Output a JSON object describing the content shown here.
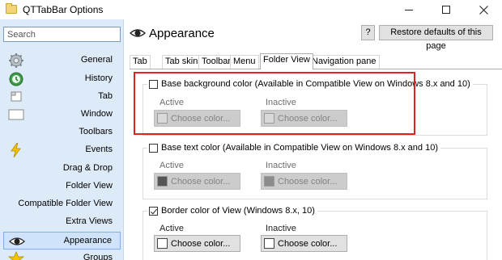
{
  "window": {
    "title": "QTTabBar Options",
    "controls": [
      "minimize",
      "maximize",
      "close"
    ]
  },
  "sidebar": {
    "search_placeholder": "Search",
    "items": [
      {
        "label": "General",
        "icon": "gear-icon"
      },
      {
        "label": "History",
        "icon": "history-icon"
      },
      {
        "label": "Tab",
        "icon": "tab-icon"
      },
      {
        "label": "Window",
        "icon": "window-icon"
      },
      {
        "label": "Toolbars",
        "icon": ""
      },
      {
        "label": "Events",
        "icon": "lightning-icon"
      },
      {
        "label": "Drag & Drop",
        "icon": ""
      },
      {
        "label": "Folder View",
        "icon": ""
      },
      {
        "label": "Compatible Folder View",
        "icon": ""
      },
      {
        "label": "Extra Views",
        "icon": ""
      },
      {
        "label": "Appearance",
        "icon": "eye-icon",
        "selected": true
      },
      {
        "label": "Groups",
        "icon": "star-icon"
      }
    ]
  },
  "header": {
    "title": "Appearance",
    "help_label": "?",
    "restore_label": "Restore defaults of this page"
  },
  "tabs": [
    {
      "label": "Tab"
    },
    {
      "label": "Tab skins"
    },
    {
      "label": "Toolbar"
    },
    {
      "label": "Menu"
    },
    {
      "label": "Folder View",
      "active": true
    },
    {
      "label": "Navigation pane"
    }
  ],
  "groups": [
    {
      "label": "Base background color (Available in Compatible View on Windows 8.x and 10)",
      "checked": false,
      "active_label": "Active",
      "inactive_label": "Inactive",
      "active_button": "Choose color...",
      "inactive_button": "Choose color...",
      "active_swatch": "#d9d9d9",
      "inactive_swatch": "#d9d9d9",
      "enabled": false
    },
    {
      "label": "Base text color (Available in Compatible View on Windows 8.x and 10)",
      "checked": false,
      "active_label": "Active",
      "inactive_label": "Inactive",
      "active_button": "Choose color...",
      "inactive_button": "Choose color...",
      "active_swatch": "#555555",
      "inactive_swatch": "#8c8c8c",
      "enabled": false
    },
    {
      "label": "Border color of View (Windows 8.x, 10)",
      "checked": true,
      "active_label": "Active",
      "inactive_label": "Inactive",
      "active_button": "Choose color...",
      "inactive_button": "Choose color...",
      "active_swatch": "#ffffff",
      "inactive_swatch": "#ffffff",
      "enabled": true
    }
  ],
  "colors": {
    "sidebar_bg": "#ddeaf8",
    "selected_bg": "#cfe4fa",
    "highlight": "#e2211c"
  }
}
